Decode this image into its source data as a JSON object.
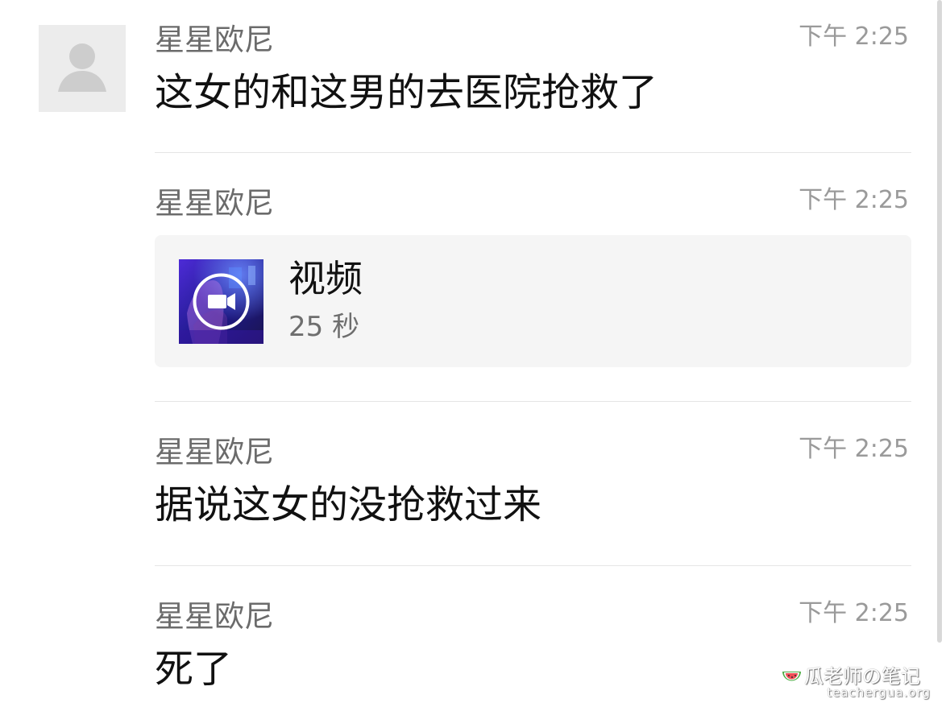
{
  "messages": [
    {
      "sender": "星星欧尼",
      "time": "下午 2:25",
      "text": "这女的和这男的去医院抢救了"
    },
    {
      "sender": "星星欧尼",
      "time": "下午 2:25",
      "video": {
        "title": "视频",
        "duration": "25 秒"
      }
    },
    {
      "sender": "星星欧尼",
      "time": "下午 2:25",
      "text": "据说这女的没抢救过来"
    },
    {
      "sender": "星星欧尼",
      "time": "下午 2:25",
      "text": "死了"
    }
  ],
  "watermark": {
    "title": "瓜老师の笔记",
    "site": "teachergua.org"
  },
  "colors": {
    "background": "#ffffff",
    "sender_text": "#6b6b6b",
    "timestamp_text": "#9a9a9a",
    "message_text": "#111111",
    "divider": "#e5e5e5",
    "video_card_background": "#f5f5f5",
    "avatar_background": "#ececec",
    "video_thumbnail": "#241b9d"
  },
  "icons": {
    "avatar": "default-user-avatar-icon",
    "video": "video-camera-icon",
    "watermark": "watermelon-icon"
  }
}
